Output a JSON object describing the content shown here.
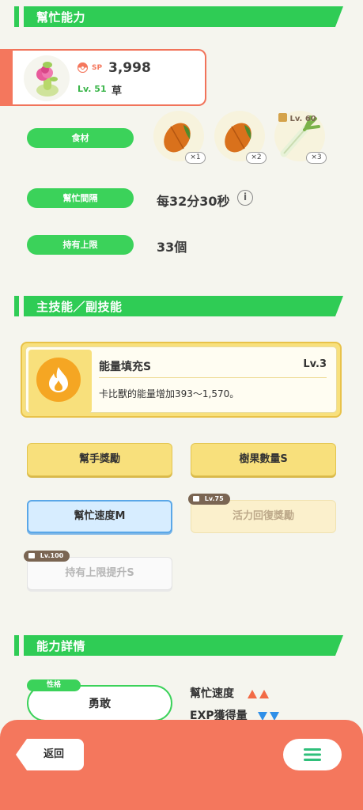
{
  "sections": {
    "help_ability": "幫忙能力",
    "skills": "主技能／副技能",
    "details": "能力詳情"
  },
  "pokemon": {
    "sp_label": "SP",
    "sp_value": "3,998",
    "level": "Lv. 51",
    "type": "草"
  },
  "rows": {
    "ingredients_label": "食材",
    "interval_label": "幫忙間隔",
    "interval_value": "每32分30秒",
    "capacity_label": "持有上限",
    "capacity_value": "33個"
  },
  "ingredients": [
    {
      "icon": "cacao-bean-icon",
      "count": "×1"
    },
    {
      "icon": "cacao-bean-icon",
      "count": "×2"
    },
    {
      "icon": "leek-icon",
      "count": "×3",
      "unlock": "Lv. 60"
    }
  ],
  "main_skill": {
    "name": "能量填充S",
    "level": "Lv.3",
    "description": "卡比獸的能量增加393～1,570。"
  },
  "sub_skills": [
    {
      "label": "幫手獎勵"
    },
    {
      "label": "樹果數量S"
    },
    {
      "label": "幫忙速度M"
    },
    {
      "label": "活力回復獎勵",
      "unlock": "Lv.75"
    },
    {
      "label": "持有上限提升S",
      "unlock": "Lv.100"
    }
  ],
  "nature": {
    "tag": "性格",
    "value": "勇敢",
    "up_label": "幫忙速度",
    "down_label": "EXP獲得量"
  },
  "footer": {
    "back": "返回"
  },
  "colors": {
    "green": "#2fcc55",
    "coral": "#f4775d",
    "yellow": "#f8e07c",
    "up_arrow": "#f26a45",
    "down_arrow": "#2f8fe8"
  }
}
